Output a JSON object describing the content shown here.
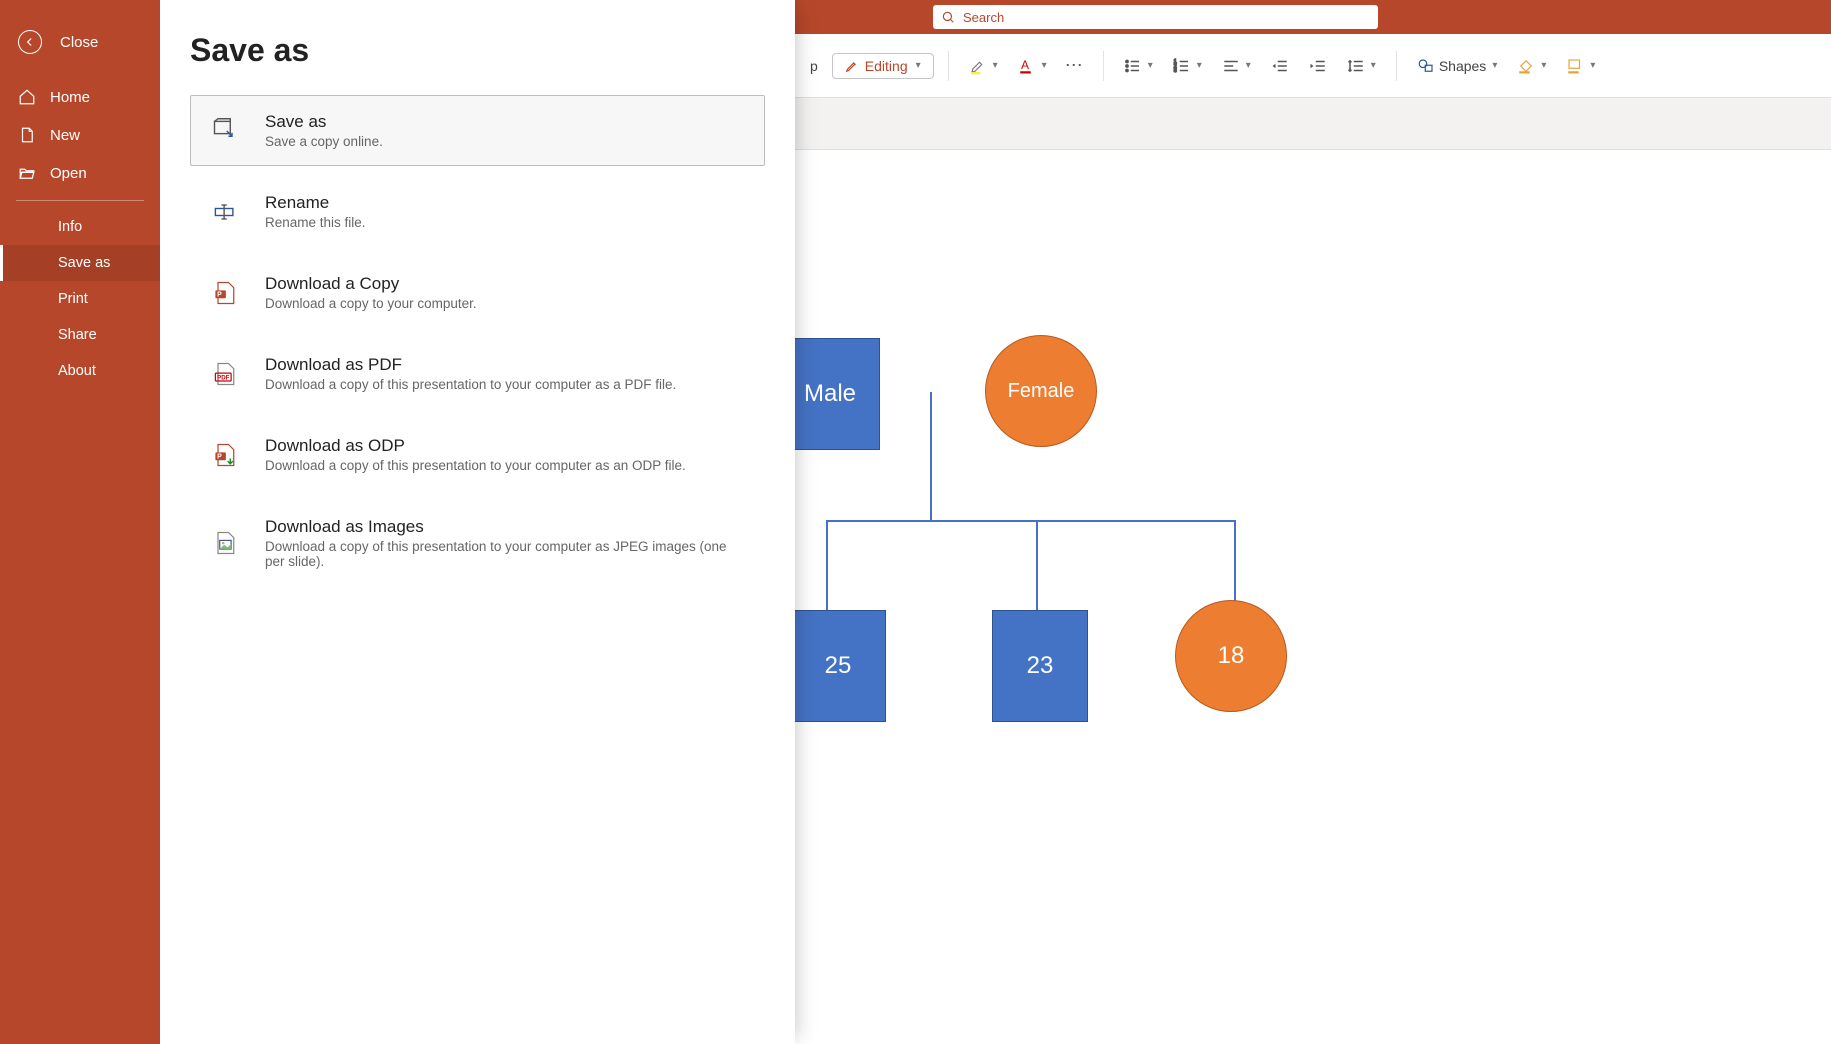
{
  "titlebar": {
    "search_placeholder": "Search"
  },
  "ribbon": {
    "tab_visible_letter": "p",
    "editing_label": "Editing",
    "shapes_label": "Shapes"
  },
  "backstage": {
    "close_label": "Close",
    "nav_primary": [
      {
        "id": "home",
        "label": "Home"
      },
      {
        "id": "new",
        "label": "New"
      },
      {
        "id": "open",
        "label": "Open"
      }
    ],
    "nav_secondary": [
      {
        "id": "info",
        "label": "Info"
      },
      {
        "id": "saveas",
        "label": "Save as",
        "active": true
      },
      {
        "id": "print",
        "label": "Print"
      },
      {
        "id": "share",
        "label": "Share"
      },
      {
        "id": "about",
        "label": "About"
      }
    ],
    "page_title": "Save as",
    "options": [
      {
        "id": "saveas",
        "title": "Save as",
        "desc": "Save a copy online.",
        "selected": true
      },
      {
        "id": "rename",
        "title": "Rename",
        "desc": "Rename this file."
      },
      {
        "id": "dlcopy",
        "title": "Download a Copy",
        "desc": "Download a copy to your computer."
      },
      {
        "id": "dlpdf",
        "title": "Download as PDF",
        "desc": "Download a copy of this presentation to your computer as a PDF file."
      },
      {
        "id": "dlodp",
        "title": "Download as ODP",
        "desc": "Download a copy of this presentation to your computer as an ODP file."
      },
      {
        "id": "dlimg",
        "title": "Download as Images",
        "desc": "Download a copy of this presentation to your computer as JPEG images (one per slide)."
      }
    ]
  },
  "diagram": {
    "nodes": [
      {
        "id": "male",
        "label": "Male",
        "shape": "rect"
      },
      {
        "id": "female",
        "label": "Female",
        "shape": "circ"
      },
      {
        "id": "n25",
        "label": "25",
        "shape": "rect"
      },
      {
        "id": "n23",
        "label": "23",
        "shape": "rect"
      },
      {
        "id": "n18",
        "label": "18",
        "shape": "circ"
      }
    ]
  },
  "colors": {
    "brand": "#b7472a",
    "blue": "#4472c4",
    "orange": "#ed7d31"
  }
}
